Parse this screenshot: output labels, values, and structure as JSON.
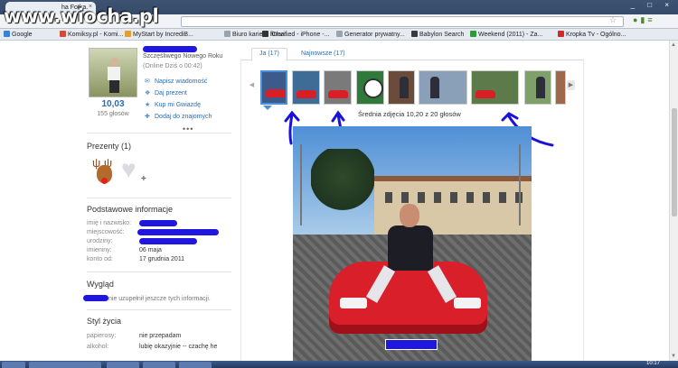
{
  "watermark": "www.wiocha.pl",
  "browser": {
    "tab_title": "ha Fotka.",
    "tab_close": "×",
    "window_controls": "_ □ ×",
    "bookmarks": [
      {
        "label": "Google",
        "color": "#3b82d6"
      },
      {
        "label": "Komiksy.pl - Komi...",
        "color": "#d64a3b"
      },
      {
        "label": "MyStart by IncrediB...",
        "color": "#e0a030"
      },
      {
        "label": "Biuro karier - firma:...",
        "color": "#9aa3ad"
      },
      {
        "label": "iClarified - iPhone -...",
        "color": "#333333"
      },
      {
        "label": "Generator prywatny...",
        "color": "#9aa3ad"
      },
      {
        "label": "Babylon Search",
        "color": "#3a3a3a"
      },
      {
        "label": "Weekend (2011) - Za...",
        "color": "#2f9a3a"
      },
      {
        "label": "Kropka Tv - Ogólno...",
        "color": "#d62a2a"
      }
    ]
  },
  "profile": {
    "status": "Szczęśliwego Nowego Roku",
    "online": "(Online Dziś o 00:42)",
    "rating": "10,03",
    "votes": "155 głosów",
    "actions": [
      {
        "label": "Napisz wiadomość",
        "icon": "envelope-icon",
        "glyph": "✉"
      },
      {
        "label": "Daj prezent",
        "icon": "gift-icon",
        "glyph": "❖"
      },
      {
        "label": "Kup mi Gwiazdę",
        "icon": "star-icon",
        "glyph": "★"
      },
      {
        "label": "Dodaj do znajomych",
        "icon": "add-friend-icon",
        "glyph": "✚"
      }
    ],
    "more": "•••"
  },
  "gifts": {
    "title": "Prezenty (1)"
  },
  "basic_info": {
    "title": "Podstawowe informacje",
    "rows": [
      {
        "label": "imię i nazwisko:",
        "value": ""
      },
      {
        "label": "miejscowość:",
        "value": ""
      },
      {
        "label": "urodziny:",
        "value": ""
      },
      {
        "label": "imieniny:",
        "value": "06 maja"
      },
      {
        "label": "konto od:",
        "value": "17 grudnia 2011"
      }
    ]
  },
  "appearance": {
    "title": "Wygląd",
    "text": "nie uzupełnił jeszcze tych informacji."
  },
  "lifestyle": {
    "title": "Styl życia",
    "rows": [
      {
        "label": "papierosy:",
        "value": "nie przepadam"
      },
      {
        "label": "alkohol:",
        "value": "lubię okazyjnie -- czachę he"
      }
    ]
  },
  "gallery": {
    "tabs": [
      "Ja (17)",
      "Najnowsze (17)"
    ],
    "active_tab": 0,
    "rating_text": "Średnia zdjęcia 10,20 z 20 głosów",
    "thumbs": [
      {
        "kind": "car",
        "bg": "#3d5a8a"
      },
      {
        "kind": "car",
        "bg": "#3f6c96"
      },
      {
        "kind": "car",
        "bg": "#7a7a7a"
      },
      {
        "kind": "ball",
        "bg": "#2f7a3a"
      },
      {
        "kind": "person",
        "bg": "#6b4b3a"
      },
      {
        "kind": "person",
        "bg": "#8aa0b8"
      },
      {
        "kind": "car",
        "bg": "#5c7a4a"
      },
      {
        "kind": "person",
        "bg": "#7fa06a"
      },
      {
        "kind": "person",
        "bg": "#9c6a4a"
      }
    ]
  },
  "taskbar": {
    "clock": "10:17"
  }
}
